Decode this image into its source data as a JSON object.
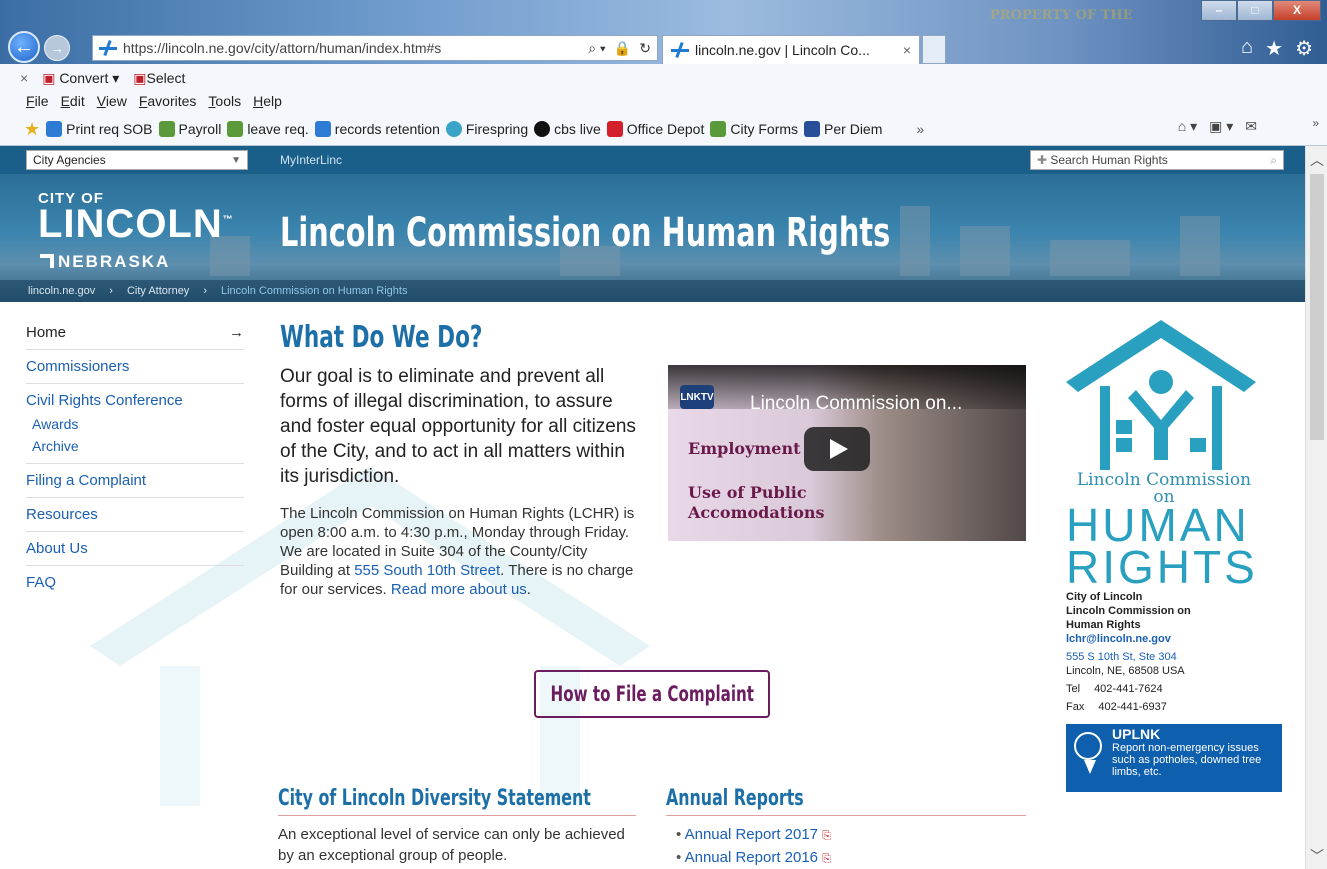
{
  "browser": {
    "url": "https://lincoln.ne.gov/city/attorn/human/index.htm#s",
    "tab_title": "lincoln.ne.gov | Lincoln Co...",
    "tab_close": "×",
    "watermark": "PROPERTY OF THE",
    "min_label": "–",
    "max_label": "□",
    "close_label": "X",
    "back_label": "←",
    "forward_label": "→",
    "addr_search": "⌕ ▾",
    "addr_lock": "🔒",
    "addr_refresh": "↻",
    "right_icons": {
      "home": "⌂",
      "star": "★",
      "gear": "⚙"
    }
  },
  "cmdbar": {
    "close": "×",
    "convert": "Convert ▾",
    "select": "Select"
  },
  "menu": [
    "File",
    "Edit",
    "View",
    "Favorites",
    "Tools",
    "Help"
  ],
  "favorites": [
    {
      "label": "Print req SOB",
      "color": "#2e7bd6"
    },
    {
      "label": "Payroll",
      "color": "#5a9a3a"
    },
    {
      "label": "leave req.",
      "color": "#5a9a3a"
    },
    {
      "label": "records retention",
      "color": "#2e7bd6"
    },
    {
      "label": "Firespring",
      "color": "#3aa4c8"
    },
    {
      "label": "cbs live",
      "color": "#111111"
    },
    {
      "label": "Office Depot",
      "color": "#d4202a"
    },
    {
      "label": "City Forms",
      "color": "#5a9a3a"
    },
    {
      "label": "Per Diem",
      "color": "#2a4f9a"
    }
  ],
  "fav_overflow": "»",
  "toolbar_right": [
    "⌂ ▾",
    "▣ ▾",
    "✉"
  ],
  "site": {
    "agencies_label": "City Agencies",
    "myinterlinc": "MyInterLinc",
    "search_placeholder": "Search Human Rights",
    "logo_city": "CITY OF",
    "logo_lincoln": "LINCOLN",
    "logo_tm": "™",
    "logo_ne": "NEBRASKA",
    "banner_title": "Lincoln Commission on Human Rights",
    "breadcrumb": [
      "lincoln.ne.gov",
      "City Attorney",
      "Lincoln Commission on Human Rights"
    ]
  },
  "nav": {
    "home": "Home",
    "home_arrow": "→",
    "commissioners": "Commissioners",
    "conference": "Civil Rights Conference",
    "awards": "Awards",
    "archive": "Archive",
    "filing": "Filing a Complaint",
    "resources": "Resources",
    "about": "About Us",
    "faq": "FAQ"
  },
  "main": {
    "heading": "What Do We Do?",
    "goal": "Our goal is to eliminate and prevent all forms of illegal discrimination, to assure and foster equal opportunity for all citizens of the City, and to act in all matters within its jurisdiction.",
    "info_1": "The Lincoln Commission on Human Rights (LCHR) is open 8:00 a.m. to 4:30 p.m., Monday through Friday. We are located in Suite 304 of the County/City Building at ",
    "info_link_1": "555 South 10th Street",
    "info_2": ". There is no charge for our services. ",
    "info_link_2": "Read more about us",
    "info_3": ".",
    "file_button": "How to File a Complaint",
    "diversity_heading": "City of Lincoln Diversity Statement",
    "diversity_text": "An exceptional level of service can only be achieved by an exceptional group of people.",
    "annual_heading": "Annual Reports",
    "annual_reports": [
      "Annual Report 2017",
      "Annual Report 2016"
    ],
    "pdf_icon": "⎘"
  },
  "video": {
    "badge": "LNKTV",
    "badge_sub": "CITY",
    "title": "Lincoln Commission on...",
    "line1": "Employment",
    "line2": "Use of Public",
    "line3": "Accomodations"
  },
  "sidebar": {
    "org_line1": "Lincoln Commission",
    "org_line2": "on",
    "human": "HUMAN",
    "rights": "RIGHTS",
    "contact_city": "City of Lincoln",
    "contact_org1": "Lincoln Commission on",
    "contact_org2": "Human Rights",
    "email": "lchr@lincoln.ne.gov",
    "address1": "555 S 10th St, Ste 304",
    "address2": "Lincoln, NE, 68508 USA",
    "tel_label": "Tel",
    "tel": "402-441-7624",
    "fax_label": "Fax",
    "fax": "402-441-6937",
    "uplnk_title": "UPLNK",
    "uplnk_text": "Report non-emergency issues such as potholes, downed tree limbs, etc."
  },
  "colors": {
    "banner": "#2c6f97",
    "heading": "#1d6fa8",
    "button": "#6b1d5f",
    "uplnk": "#0e5fae",
    "logo_teal": "#2aa0c0"
  }
}
